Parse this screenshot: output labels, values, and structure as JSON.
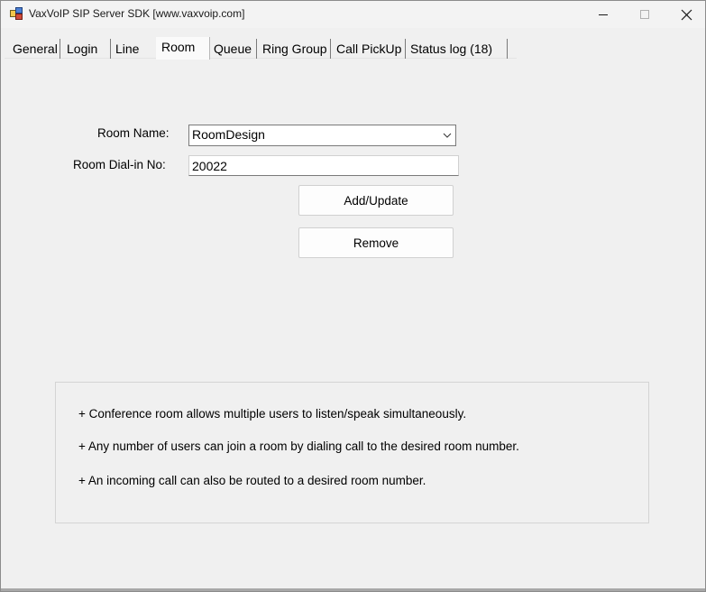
{
  "window": {
    "title": "VaxVoIP SIP Server SDK [www.vaxvoip.com]"
  },
  "tabs": [
    {
      "label": "General"
    },
    {
      "label": "Login"
    },
    {
      "label": "Line"
    },
    {
      "label": "Room"
    },
    {
      "label": "Queue"
    },
    {
      "label": "Ring Group"
    },
    {
      "label": "Call PickUp"
    },
    {
      "label": "Status log (18)"
    }
  ],
  "active_tab": "Room",
  "form": {
    "room_name_label": "Room Name:",
    "room_name_value": "RoomDesign",
    "dial_in_label": "Room Dial-in No:",
    "dial_in_value": "20022",
    "add_update_label": "Add/Update",
    "remove_label": "Remove"
  },
  "info": {
    "lines": [
      "+ Conference room allows multiple users to listen/speak simultaneously.",
      "+ Any number of users can join a room by dialing call to the desired room number.",
      "+ An incoming call can also be routed to a desired room number."
    ]
  },
  "icons": {
    "app": "app-icon",
    "minimize": "minimize-icon",
    "maximize": "maximize-icon",
    "close": "close-icon",
    "dropdown": "chevron-down-icon"
  }
}
